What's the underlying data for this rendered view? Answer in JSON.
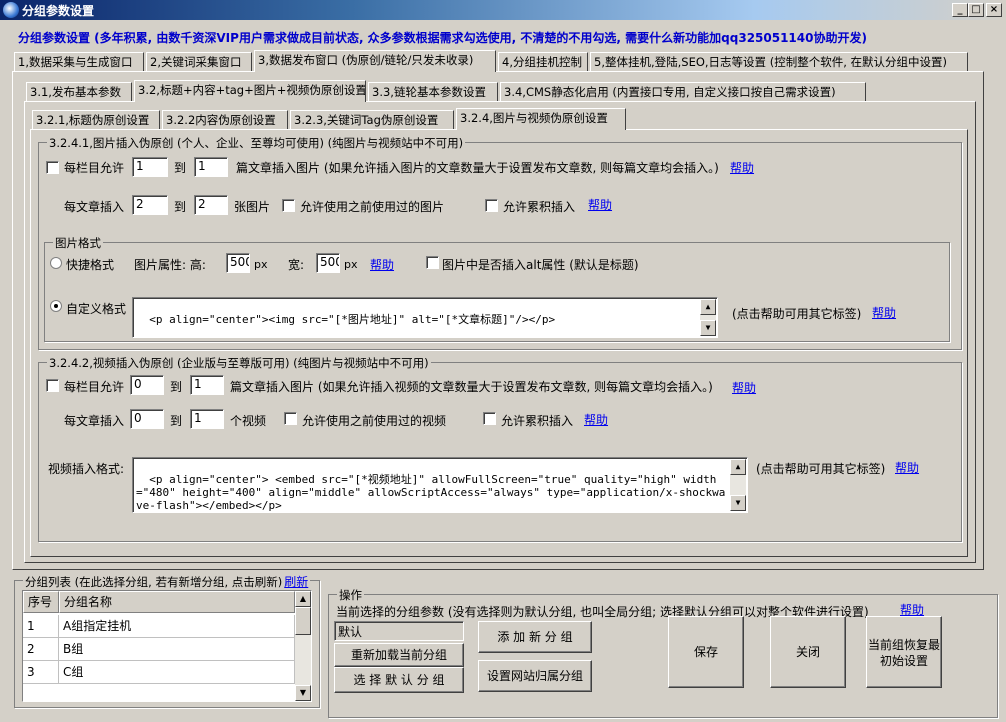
{
  "window": {
    "title": "分组参数设置",
    "min": "_",
    "max": "□",
    "close": "×"
  },
  "header_note": "分组参数设置 (多年积累, 由数千资深VIP用户需求做成目前状态, 众多参数根据需求勾选使用, 不清楚的不用勾选, 需要什么新功能加qq325051140协助开发)",
  "tabs_l1": [
    "1,数据采集与生成窗口",
    "2,关键词采集窗口",
    "3,数据发布窗口 (伪原创/链轮/只发未收录)",
    "4,分组挂机控制",
    "5,整体挂机,登陆,SEO,日志等设置 (控制整个软件, 在默认分组中设置)"
  ],
  "tabs_l2": [
    "3.1,发布基本参数",
    "3.2,标题+内容+tag+图片+视频伪原创设置",
    "3.3,链轮基本参数设置",
    "3.4,CMS静态化启用 (内置接口专用, 自定义接口按自己需求设置)"
  ],
  "tabs_l3": [
    "3.2.1,标题伪原创设置",
    "3.2.2内容伪原创设置",
    "3.2.3,关键词Tag伪原创设置",
    "3.2.4,图片与视频伪原创设置"
  ],
  "img": {
    "group_title": "3.2.4.1,图片插入伪原创 (个人、企业、至尊均可使用) (纯图片与视频站中不可用)",
    "per_col_label": "每栏目允许",
    "per_col_from": "1",
    "to": "到",
    "per_col_to": "1",
    "per_col_desc": "篇文章插入图片 (如果允许插入图片的文章数量大于设置发布文章数, 则每篇文章均会插入。)",
    "help": "帮助",
    "per_art_label": "每文章插入",
    "per_art_from": "2",
    "per_art_to": "2",
    "per_art_unit": "张图片",
    "allow_prev": "允许使用之前使用过的图片",
    "allow_accum": "允许累积插入",
    "format_group": "图片格式",
    "quick": "快捷格式",
    "attr_label": "图片属性: 高:",
    "height": "500",
    "px": "px",
    "width_label": "宽:",
    "width": "500",
    "alt_option": "图片中是否插入alt属性 (默认是标题)",
    "custom": "自定义格式",
    "custom_value": "<p align=\"center\"><img src=\"[*图片地址]\" alt=\"[*文章标题]\"/></p>",
    "custom_hint": "(点击帮助可用其它标签)"
  },
  "video": {
    "group_title": "3.2.4.2,视频插入伪原创 (企业版与至尊版可用) (纯图片与视频站中不可用)",
    "per_col_label": "每栏目允许",
    "per_col_from": "0",
    "per_col_to": "1",
    "per_col_desc": "篇文章插入图片 (如果允许插入视频的文章数量大于设置发布文章数, 则每篇文章均会插入。)",
    "per_art_label": "每文章插入",
    "per_art_from": "0",
    "per_art_to": "1",
    "per_art_unit": "个视频",
    "allow_prev": "允许使用之前使用过的视频",
    "allow_accum": "允许累积插入",
    "format_label": "视频插入格式:",
    "format_value": "<p align=\"center\"> <embed src=\"[*视频地址]\" allowFullScreen=\"true\" quality=\"high\" width=\"480\" height=\"400\" align=\"middle\" allowScriptAccess=\"always\" type=\"application/x-shockwave-flash\"></embed></p>",
    "format_hint": "(点击帮助可用其它标签)"
  },
  "group_list": {
    "title": "分组列表 (在此选择分组, 若有新增分组, 点击刷新)",
    "refresh": "刷新",
    "col_no": "序号",
    "col_name": "分组名称",
    "rows": [
      {
        "no": "1",
        "name": "A组指定挂机"
      },
      {
        "no": "2",
        "name": "B组"
      },
      {
        "no": "3",
        "name": "C组"
      }
    ]
  },
  "ops": {
    "title": "操作",
    "desc": "当前选择的分组参数 (没有选择则为默认分组, 也叫全局分组; 选择默认分组可以对整个软件进行设置)",
    "help": "帮助",
    "current": "默认",
    "reload": "重新加载当前分组",
    "select_default": "选 择 默 认 分 组",
    "add_group": "添 加 新 分 组",
    "site_group": "设置网站归属分组",
    "save": "保存",
    "close": "关闭",
    "restore": "当前组恢复最初始设置"
  }
}
